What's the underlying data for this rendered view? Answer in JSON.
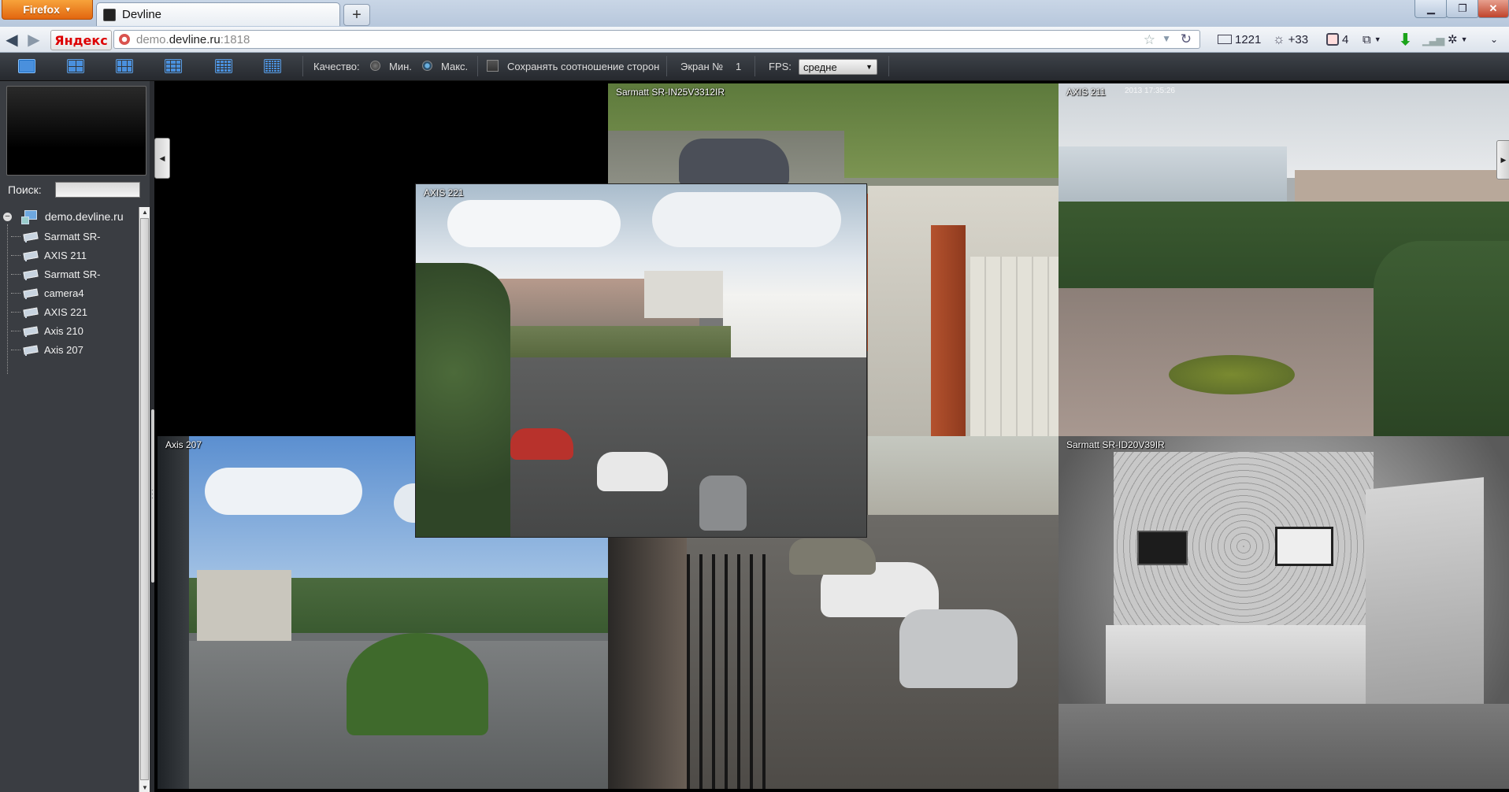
{
  "browser": {
    "app_button": "Firefox",
    "tab_title": "Devline",
    "new_tab": "+",
    "url_prefix": "demo.",
    "url_host": "devline.ru",
    "url_port": ":1818",
    "yandex_label": "Яндекс",
    "ext_mail_count": "1221",
    "ext_weather": "+33",
    "ext_count": "4"
  },
  "toolbar": {
    "quality_label": "Качество:",
    "quality_min": "Мин.",
    "quality_max": "Макс.",
    "keep_aspect_label": "Сохранять соотношение сторон",
    "screen_label": "Экран №",
    "screen_number": "1",
    "fps_label": "FPS:",
    "fps_value": "средне",
    "accent_color": "#1f6fc4"
  },
  "sidebar": {
    "search_label": "Поиск:",
    "search_value": "",
    "tree_root": "demo.devline.ru",
    "cameras": [
      "Sarmatt SR-",
      "AXIS 211",
      "Sarmatt SR-",
      "camera4",
      "AXIS 221",
      "Axis 210",
      "Axis 207"
    ]
  },
  "views": {
    "cam_top_middle": "Sarmatt SR-IN25V3312IR",
    "cam_top_right": "AXIS 211",
    "cam_top_right_ts": "2013 17:35:26",
    "cam_center": "AXIS 221",
    "cam_bottom_left": "Axis 207",
    "cam_bottom_right": "Sarmatt SR-ID20V39IR"
  }
}
